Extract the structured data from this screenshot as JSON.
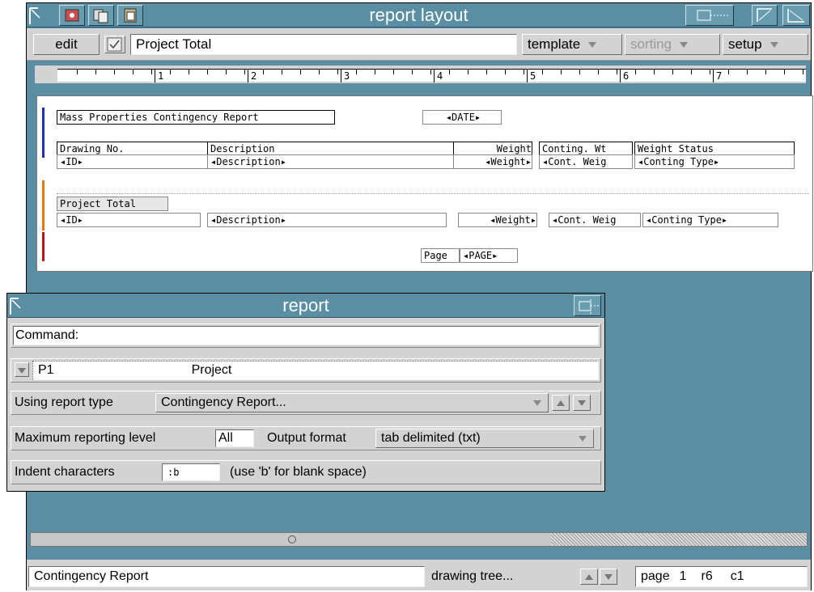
{
  "main_window": {
    "title": "report layout",
    "toolbar": {
      "edit_label": "edit",
      "name_value": "Project Total",
      "template_label": "template",
      "sorting_label": "sorting",
      "setup_label": "setup"
    },
    "ruler": [
      "1",
      "2",
      "3",
      "4",
      "5",
      "6",
      "7"
    ],
    "layout": {
      "report_title": "Mass Properties Contingency Report",
      "date_field": "◂DATE▸",
      "headers": [
        "Drawing No.",
        "Description",
        "Weight",
        "Conting. Wt",
        "Weight Status"
      ],
      "detail": [
        "◂ID▸",
        "◂Description▸",
        "◂Weight▸",
        "◂Cont. Weig",
        "◂Conting Type▸"
      ],
      "group_label": "Project Total",
      "group_detail": [
        "◂ID▸",
        "◂Description▸",
        "◂Weight▸",
        "◂Cont. Weig",
        "◂Conting Type▸"
      ],
      "page_label": "Page",
      "page_field": "◂PAGE▸"
    },
    "status": {
      "left": "Contingency Report",
      "tree": "drawing tree...",
      "page": "page",
      "page_num": "1",
      "row": "r6",
      "col": "c1"
    }
  },
  "report_dialog": {
    "title": "report",
    "command_label": "Command:",
    "command_value": "",
    "item_code": "P1",
    "item_name": "Project",
    "report_type_label": "Using report type",
    "report_type_value": "Contingency Report...",
    "max_level_label": "Maximum reporting level",
    "max_level_value": "All",
    "output_format_label": "Output format",
    "output_format_value": "tab delimited (txt)",
    "indent_label": "Indent characters",
    "indent_value": ":b",
    "indent_hint": "(use 'b' for blank space)"
  },
  "colors": {
    "window_bg": "#5a8ea3",
    "panel_bg": "#d3d3d3",
    "band_blue": "#1f2fb8",
    "band_orange": "#e07a10",
    "band_red": "#c0141b"
  },
  "icons": [
    "system-menu-icon",
    "print-icon",
    "copy-icon",
    "paste-icon",
    "resize-icon",
    "maximize-icon",
    "close-icon"
  ]
}
